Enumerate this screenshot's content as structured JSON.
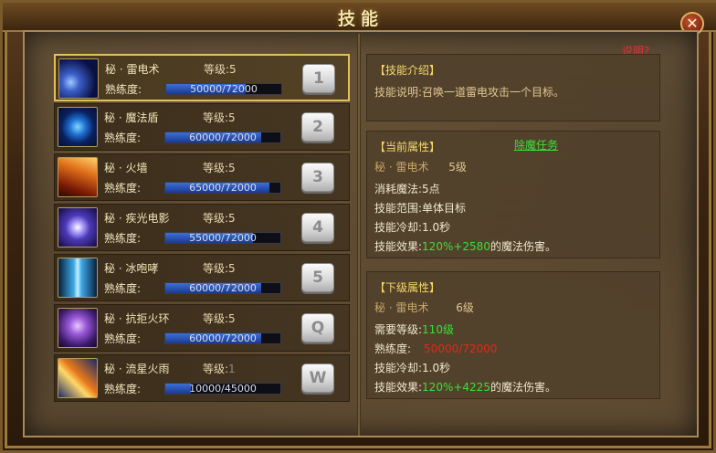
{
  "window": {
    "title": "技能",
    "close_glyph": "✕"
  },
  "help_link": "说明?",
  "skills": [
    {
      "name": "秘 · 雷电术",
      "level_label": "等级:",
      "level": "5",
      "prof_label": "熟练度:",
      "prof_text": "50000/72000",
      "prof_ratio": 0.694,
      "hotkey": "1",
      "selected": true
    },
    {
      "name": "秘 · 魔法盾",
      "level_label": "等级:",
      "level": "5",
      "prof_label": "熟练度:",
      "prof_text": "60000/72000",
      "prof_ratio": 0.833,
      "hotkey": "2"
    },
    {
      "name": "秘 · 火墙",
      "level_label": "等级:",
      "level": "5",
      "prof_label": "熟练度:",
      "prof_text": "65000/72000",
      "prof_ratio": 0.903,
      "hotkey": "3"
    },
    {
      "name": "秘 · 疾光电影",
      "level_label": "等级:",
      "level": "5",
      "prof_label": "熟练度:",
      "prof_text": "55000/72000",
      "prof_ratio": 0.764,
      "hotkey": "4"
    },
    {
      "name": "秘 · 冰咆哮",
      "level_label": "等级:",
      "level": "5",
      "prof_label": "熟练度:",
      "prof_text": "60000/72000",
      "prof_ratio": 0.833,
      "hotkey": "5"
    },
    {
      "name": "秘 · 抗拒火环",
      "level_label": "等级:",
      "level": "5",
      "prof_label": "熟练度:",
      "prof_text": "60000/72000",
      "prof_ratio": 0.833,
      "hotkey": "Q"
    },
    {
      "name": "秘 · 流星火雨",
      "level_label": "等级:",
      "level": "1",
      "prof_label": "熟练度:",
      "prof_text": "10000/45000",
      "prof_ratio": 0.222,
      "hotkey": "W"
    }
  ],
  "intro": {
    "header": "【技能介绍】",
    "desc_label": "技能说明:",
    "desc_text": "召唤一道雷电攻击一个目标。"
  },
  "current": {
    "header": "【当前属性】",
    "quest_link": "除魔任务",
    "skill_name": "秘 · 雷电术",
    "skill_level": "5级",
    "mana": "消耗魔法:5点",
    "range": "技能范围:单体目标",
    "cooldown": "技能冷却:1.0秒",
    "effect_label": "技能效果:",
    "effect_value": "120%+2580",
    "effect_suffix": "的魔法伤害。"
  },
  "next": {
    "header": "【下级属性】",
    "skill_name": "秘 · 雷电术",
    "skill_level": "6级",
    "req_label": "需要等级:",
    "req_value": "110级",
    "prof_label": "熟练度:",
    "prof_value": "50000/72000",
    "cooldown": "技能冷却:1.0秒",
    "effect_label": "技能效果:",
    "effect_value": "120%+4225",
    "effect_suffix": "的魔法伤害。"
  }
}
